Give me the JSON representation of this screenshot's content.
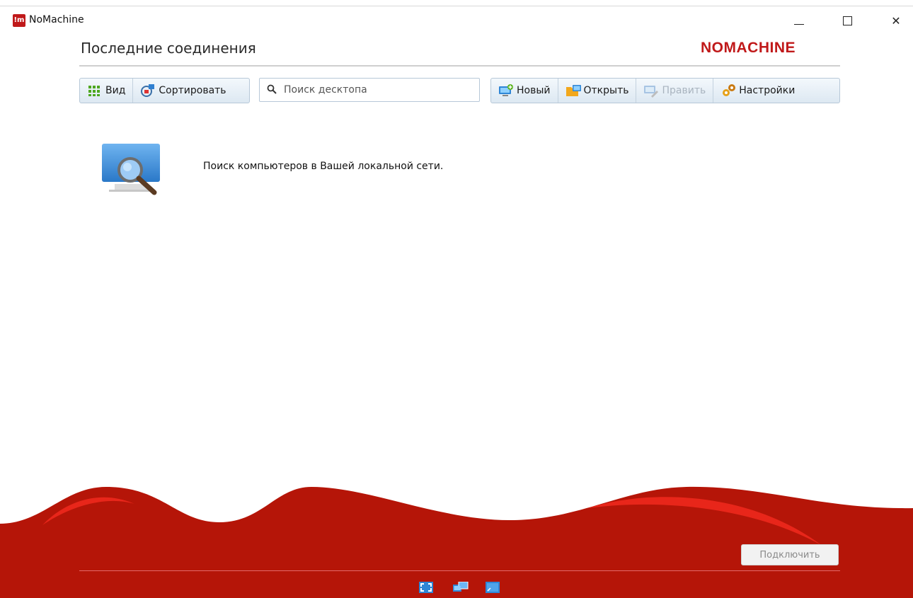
{
  "window": {
    "app_logo_text": "!m",
    "title": "NoMachine",
    "controls": {
      "minimize": "minimize",
      "maximize": "maximize",
      "close": "✕"
    }
  },
  "header": {
    "page_title": "Последние соединения",
    "brand": "NOMACHINE"
  },
  "toolbar": {
    "view_label": "Вид",
    "sort_label": "Сортировать",
    "search_placeholder": "Поиск десктопа",
    "search_value": "",
    "new_label": "Новый",
    "open_label": "Открыть",
    "edit_label": "Править",
    "settings_label": "Настройки"
  },
  "content": {
    "finder_text": "Поиск компьютеров в Вашей локальной сети."
  },
  "footer": {
    "connect_label": "Подключить",
    "icons": [
      "fullscreen-icon",
      "multi-window-icon",
      "window-icon"
    ]
  },
  "colors": {
    "brand_red": "#c0191a",
    "wave_red": "#b51508",
    "wave_highlight": "#e8261a",
    "toolbar_border": "#b7c8d8"
  }
}
